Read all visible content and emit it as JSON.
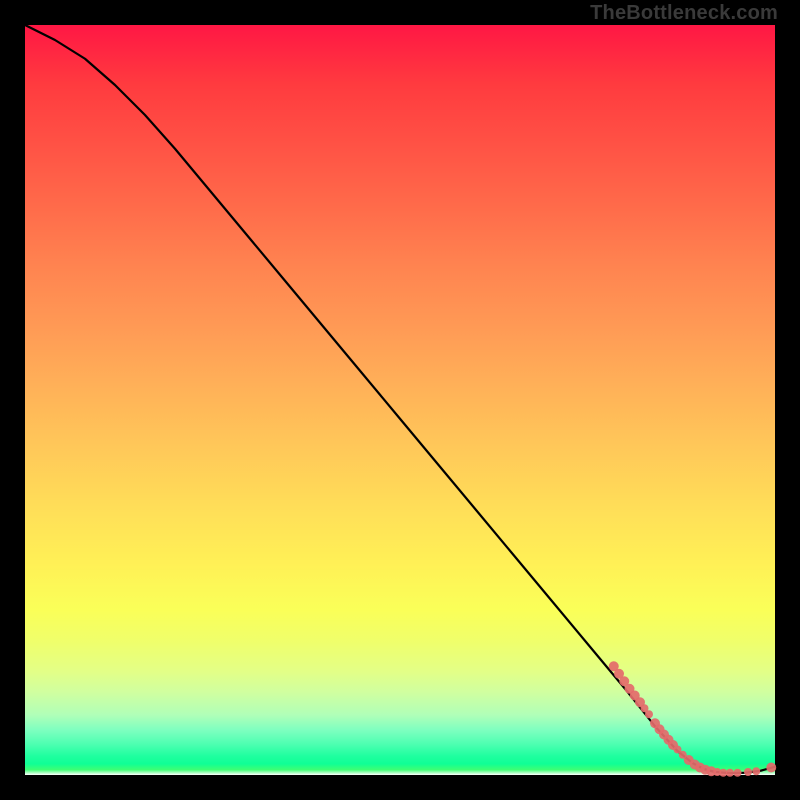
{
  "watermark": "TheBottleneck.com",
  "chart_data": {
    "type": "line",
    "title": "",
    "xlabel": "",
    "ylabel": "",
    "xlim": [
      0,
      100
    ],
    "ylim": [
      0,
      100
    ],
    "series": [
      {
        "name": "curve",
        "x": [
          0,
          4,
          8,
          12,
          16,
          20,
          25,
          30,
          35,
          40,
          45,
          50,
          55,
          60,
          65,
          70,
          75,
          80,
          84,
          87,
          89,
          90.5,
          92,
          94,
          96,
          98,
          100
        ],
        "y": [
          100,
          98,
          95.5,
          92,
          88,
          83.5,
          77.5,
          71.5,
          65.5,
          59.5,
          53.5,
          47.5,
          41.5,
          35.5,
          29.5,
          23.5,
          17.5,
          11.5,
          6.5,
          3.2,
          1.6,
          0.8,
          0.4,
          0.25,
          0.3,
          0.55,
          1.1
        ]
      }
    ],
    "scatter": {
      "name": "dots",
      "color": "#e46a6a",
      "points": [
        {
          "x": 78.5,
          "y": 14.5,
          "r": 5
        },
        {
          "x": 79.2,
          "y": 13.5,
          "r": 5
        },
        {
          "x": 79.9,
          "y": 12.5,
          "r": 5
        },
        {
          "x": 80.6,
          "y": 11.5,
          "r": 5
        },
        {
          "x": 81.3,
          "y": 10.6,
          "r": 5
        },
        {
          "x": 82.0,
          "y": 9.7,
          "r": 5
        },
        {
          "x": 82.6,
          "y": 8.9,
          "r": 4
        },
        {
          "x": 83.2,
          "y": 8.1,
          "r": 4
        },
        {
          "x": 84.0,
          "y": 6.9,
          "r": 5
        },
        {
          "x": 84.6,
          "y": 6.1,
          "r": 5
        },
        {
          "x": 85.2,
          "y": 5.4,
          "r": 5
        },
        {
          "x": 85.8,
          "y": 4.7,
          "r": 5
        },
        {
          "x": 86.4,
          "y": 4.0,
          "r": 5
        },
        {
          "x": 87.0,
          "y": 3.4,
          "r": 4
        },
        {
          "x": 87.7,
          "y": 2.7,
          "r": 4
        },
        {
          "x": 88.5,
          "y": 2.0,
          "r": 5
        },
        {
          "x": 89.3,
          "y": 1.4,
          "r": 5
        },
        {
          "x": 90.0,
          "y": 1.0,
          "r": 5
        },
        {
          "x": 90.7,
          "y": 0.7,
          "r": 5
        },
        {
          "x": 91.5,
          "y": 0.5,
          "r": 5
        },
        {
          "x": 92.3,
          "y": 0.4,
          "r": 4
        },
        {
          "x": 93.1,
          "y": 0.3,
          "r": 4
        },
        {
          "x": 94.0,
          "y": 0.3,
          "r": 4
        },
        {
          "x": 95.0,
          "y": 0.3,
          "r": 4
        },
        {
          "x": 96.4,
          "y": 0.4,
          "r": 4
        },
        {
          "x": 97.5,
          "y": 0.5,
          "r": 4
        },
        {
          "x": 99.5,
          "y": 1.0,
          "r": 5
        }
      ]
    }
  }
}
